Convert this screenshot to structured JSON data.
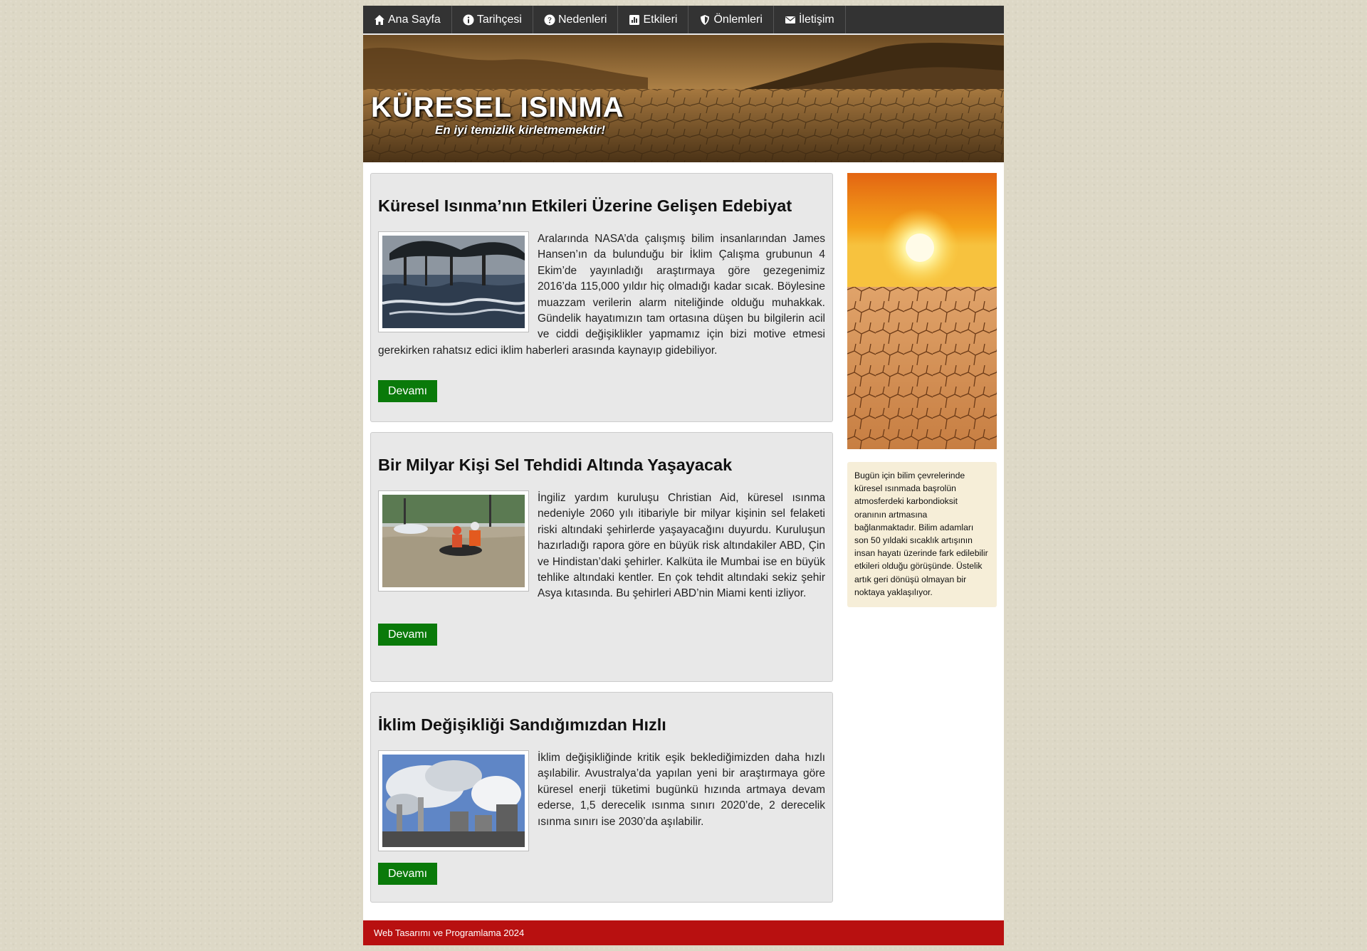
{
  "nav": {
    "items": [
      {
        "label": "Ana Sayfa",
        "icon": "home-icon"
      },
      {
        "label": "Tarihçesi",
        "icon": "info-icon"
      },
      {
        "label": "Nedenleri",
        "icon": "question-icon"
      },
      {
        "label": "Etkileri",
        "icon": "chart-icon"
      },
      {
        "label": "Önlemleri",
        "icon": "shield-icon"
      },
      {
        "label": "İletişim",
        "icon": "envelope-icon"
      }
    ]
  },
  "header": {
    "title": "KÜRESEL ISINMA",
    "slogan": "En iyi temizlik kirletmemektir!"
  },
  "articles": [
    {
      "title": "Küresel Isınma’nın Etkileri Üzerine Gelişen Edebiyat",
      "text": "Aralarında NASA’da çalışmış bilim insanlarından James Hansen’ın da bulunduğu bir İklim Çalışma grubunun 4 Ekim’de yayınladığı araştırmaya göre gezegenimiz 2016’da 115,000 yıldır hiç olmadığı kadar sıcak. Böylesine muazzam verilerin alarm niteliğinde olduğu muhakkak. Gündelik hayatımızın tam ortasına düşen bu bilgilerin acil ve ciddi değişiklikler yapmamız için bizi motive etmesi gerekirken rahatsız edici iklim haberleri arasında kaynayıp gidebiliyor.",
      "button": "Devamı"
    },
    {
      "title": "Bir Milyar Kişi Sel Tehdidi Altında Yaşayacak",
      "text": "İngiliz yardım kuruluşu Christian Aid, küresel ısınma nedeniyle 2060 yılı itibariyle bir milyar kişinin sel felaketi riski altındaki şehirlerde yaşayacağını duyurdu. Kuruluşun hazırladığı rapora göre en büyük risk altındakiler ABD, Çin ve Hindistan’daki şehirler. Kalküta ile Mumbai ise en büyük tehlike altındaki kentler. En çok tehdit altındaki sekiz şehir Asya kıtasında. Bu şehirleri ABD’nin Miami kenti izliyor.",
      "button": "Devamı"
    },
    {
      "title": "İklim Değişikliği Sandığımızdan Hızlı",
      "text": "İklim değişikliğinde kritik eşik beklediğimizden daha hızlı aşılabilir. Avustralya’da yapılan yeni bir araştırmaya göre küresel enerji tüketimi bugünkü hızında artmaya devam ederse, 1,5 derecelik ısınma sınırı 2020’de, 2 derecelik ısınma sınırı ise 2030’da aşılabilir.",
      "button": "Devamı"
    }
  ],
  "sidebar": {
    "text": "Bugün için bilim çevrelerinde küresel ısınmada başrolün atmosferdeki karbondioksit oranının artmasına bağlanmaktadır. Bilim adamları son 50 yıldaki sıcaklık artışının insan hayatı üzerinde fark edilebilir etkileri olduğu görüşünde. Üstelik artık geri dönüşü olmayan bir noktaya yaklaşılıyor."
  },
  "footer": {
    "text": "Web Tasarımı ve Programlama 2024"
  },
  "colors": {
    "nav_bg": "#333333",
    "button_bg": "#0a7a0a",
    "footer_bg": "#b81010",
    "article_bg": "#e8e8e8",
    "sidebar_box_bg": "#f6eed8"
  }
}
